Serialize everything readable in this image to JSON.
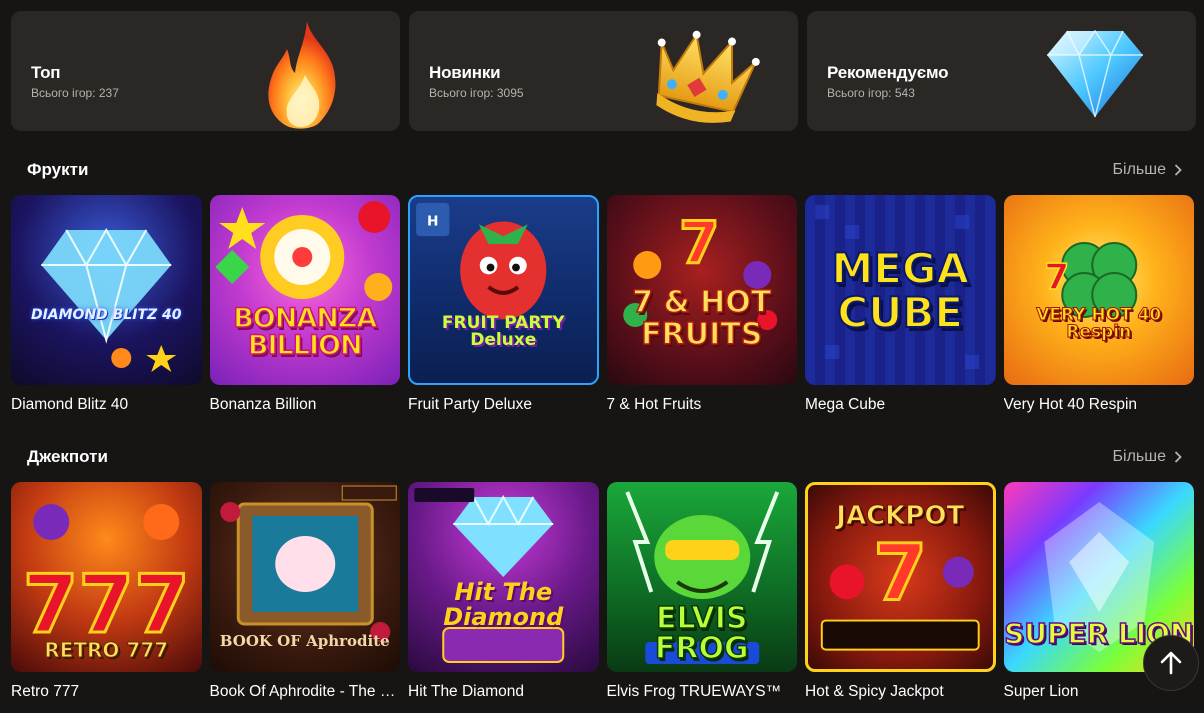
{
  "categories": [
    {
      "title": "Топ",
      "count": "Всього ігор: 237",
      "icon": "fire-icon"
    },
    {
      "title": "Новинки",
      "count": "Всього ігор: 3095",
      "icon": "crown-icon"
    },
    {
      "title": "Рекомендуємо",
      "count": "Всього ігор: 543",
      "icon": "diamond-icon"
    }
  ],
  "sections": [
    {
      "title": "Фрукти",
      "more": "Більше",
      "games": [
        {
          "name": "Diamond Blitz 40",
          "logo": "DIAMOND BLITZ 40"
        },
        {
          "name": "Bonanza Billion",
          "logo": "BONANZA BILLION"
        },
        {
          "name": "Fruit Party Deluxe",
          "logo": "FRUIT PARTY Deluxe"
        },
        {
          "name": "7 & Hot Fruits",
          "logo": "7 & HOT FRUITS"
        },
        {
          "name": "Mega Cube",
          "logo": "MEGA CUBE"
        },
        {
          "name": "Very Hot 40 Respin",
          "logo": "VERY HOT 40 Respin"
        }
      ]
    },
    {
      "title": "Джекпоти",
      "more": "Більше",
      "games": [
        {
          "name": "Retro 777",
          "logo": "RETRO 777"
        },
        {
          "name": "Book Of Aphrodite - The Love Spell",
          "logo": "BOOK OF Aphrodite"
        },
        {
          "name": "Hit The Diamond",
          "logo": "Hit The Diamond"
        },
        {
          "name": "Elvis Frog TRUEWAYS™",
          "logo": "ELVIS FROG"
        },
        {
          "name": "Hot & Spicy Jackpot",
          "logo": "JACKPOT"
        },
        {
          "name": "Super Lion",
          "logo": "SUPER LION"
        }
      ]
    }
  ],
  "scroll_top_icon": "arrow-up-icon"
}
